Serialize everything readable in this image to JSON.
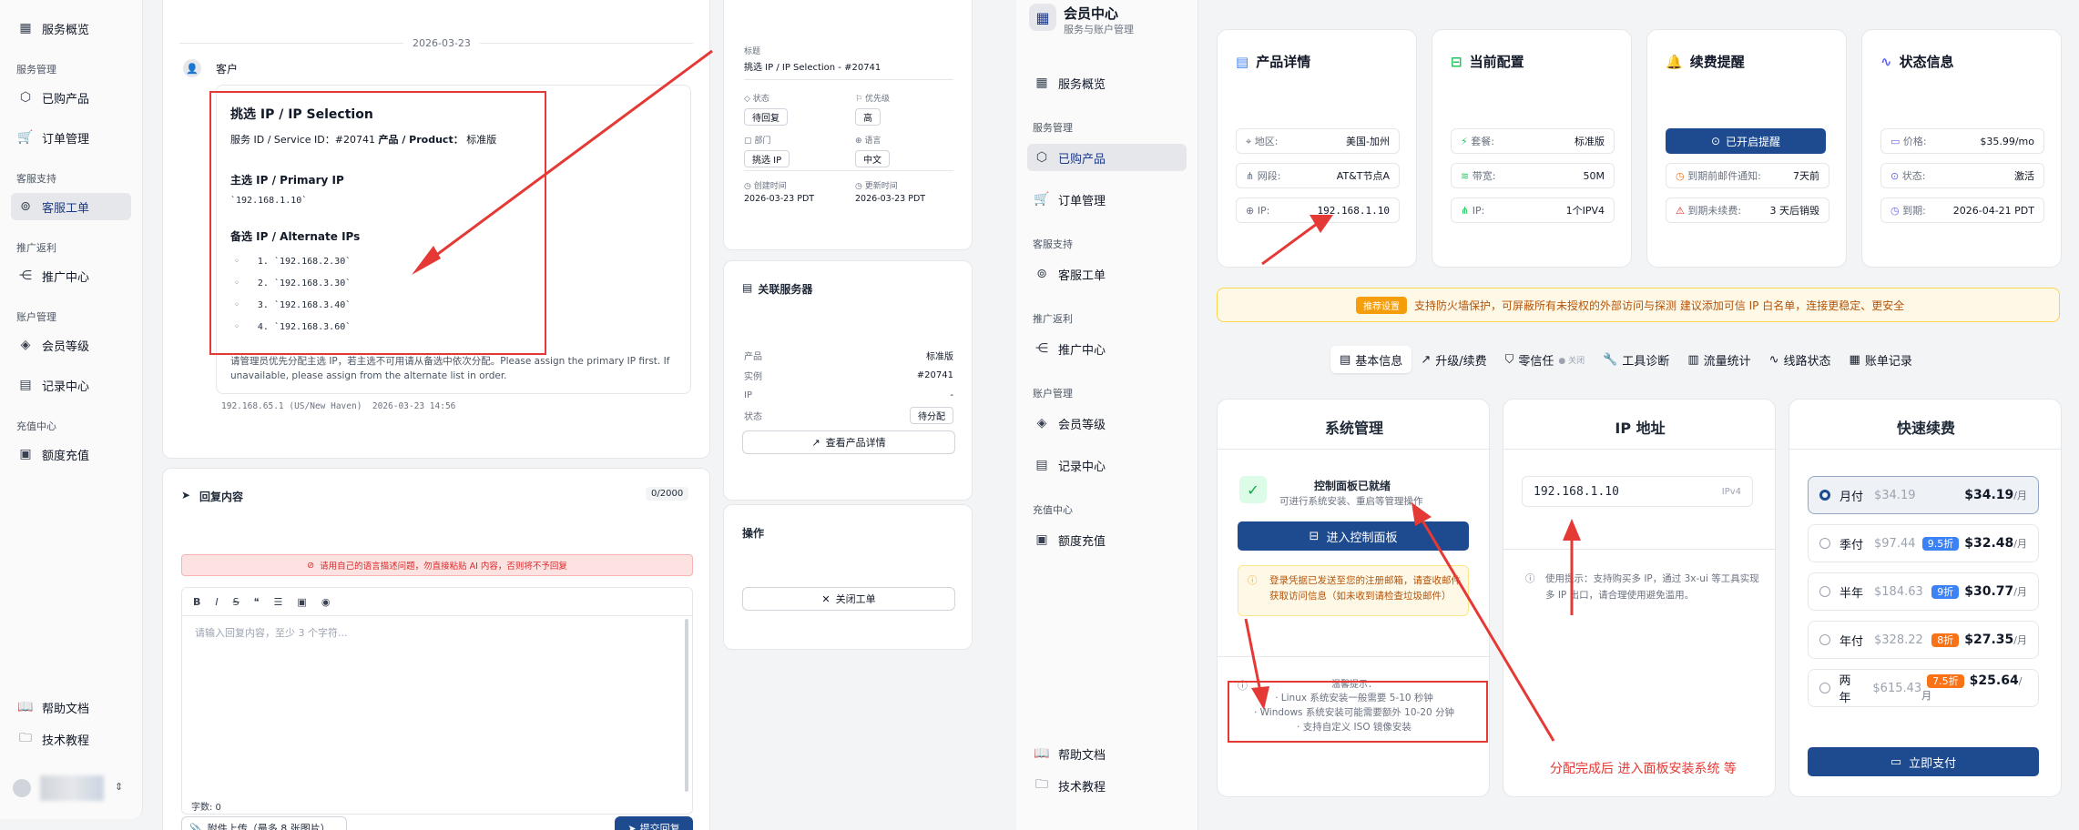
{
  "left_sidebar": {
    "items": [
      {
        "type": "item",
        "label": "服务概览",
        "icon": "grid-icon"
      },
      {
        "type": "group",
        "label": "服务管理"
      },
      {
        "type": "item",
        "label": "已购产品",
        "icon": "box-icon"
      },
      {
        "type": "item",
        "label": "订单管理",
        "icon": "cart-icon"
      },
      {
        "type": "group",
        "label": "客服支持"
      },
      {
        "type": "item",
        "label": "客服工单",
        "icon": "lifebuoy-icon",
        "active": true
      },
      {
        "type": "group",
        "label": "推广返利"
      },
      {
        "type": "item",
        "label": "推广中心",
        "icon": "share-icon"
      },
      {
        "type": "group",
        "label": "账户管理"
      },
      {
        "type": "item",
        "label": "会员等级",
        "icon": "badge-icon"
      },
      {
        "type": "item",
        "label": "记录中心",
        "icon": "record-icon"
      },
      {
        "type": "group",
        "label": "充值中心"
      },
      {
        "type": "item",
        "label": "额度充值",
        "icon": "wallet-icon"
      }
    ],
    "bottom": [
      {
        "label": "帮助文档",
        "icon": "book-icon"
      },
      {
        "label": "技术教程",
        "icon": "folder-icon"
      }
    ]
  },
  "ticket": {
    "date_divider": "2026-03-23",
    "sender": "客户",
    "msg_title": "挑选 IP / IP Selection",
    "service_prefix": "服务 ID / Service ID：",
    "service_id": "#20741",
    "product_prefix": "产品 / Product：",
    "product": "标准版",
    "primary_heading": "主选 IP / Primary IP",
    "primary_ip": "`192.168.1.10`",
    "alt_heading": "备选 IP / Alternate IPs",
    "alt_ips": [
      "1. `192.168.2.30`",
      "2. `192.168.3.30`",
      "3. `192.168.3.40`",
      "4. `192.168.3.60`"
    ],
    "note": "请管理员优先分配主选 IP，若主选不可用请从备选中依次分配。Please assign the primary IP first. If unavailable, please assign from the alternate list in order.",
    "meta": "192.168.65.1 (US/New Haven)  2026-03-23 14:56"
  },
  "reply": {
    "title": "回复内容",
    "counter": "0/2000",
    "warning": "请用自己的语言描述问题，勿直接粘贴 AI 内容，否则将不予回复",
    "placeholder": "请输入回复内容，至少 3 个字符...",
    "char_count": "字数: 0",
    "attach": "附件上传（最多 8 张图片）",
    "submit": "提交回复"
  },
  "info": {
    "title_label": "标题",
    "title_value": "挑选 IP / IP Selection - #20741",
    "status_label": "状态",
    "status_value": "待回复",
    "priority_label": "优先级",
    "priority_value": "高",
    "dept_label": "部门",
    "dept_value": "挑选 IP",
    "lang_label": "语言",
    "lang_value": "中文",
    "created_label": "创建时间",
    "created_value": "2026-03-23 PDT",
    "updated_label": "更新时间",
    "updated_value": "2026-03-23 PDT"
  },
  "related": {
    "title": "关联服务器",
    "rows": [
      {
        "k": "产品",
        "v": "标准版"
      },
      {
        "k": "实例",
        "v": "#20741"
      },
      {
        "k": "IP",
        "v": "-"
      },
      {
        "k": "状态",
        "v": "待分配"
      }
    ],
    "view_button": "查看产品详情"
  },
  "ops": {
    "title": "操作",
    "close_button": "关闭工单"
  },
  "right_sidebar": {
    "app_title": "会员中心",
    "app_sub": "服务与账户管理",
    "items": [
      {
        "type": "item",
        "label": "服务概览",
        "icon": "grid-icon"
      },
      {
        "type": "group",
        "label": "服务管理"
      },
      {
        "type": "item",
        "label": "已购产品",
        "icon": "box-icon",
        "active": true
      },
      {
        "type": "item",
        "label": "订单管理",
        "icon": "cart-icon"
      },
      {
        "type": "group",
        "label": "客服支持"
      },
      {
        "type": "item",
        "label": "客服工单",
        "icon": "lifebuoy-icon"
      },
      {
        "type": "group",
        "label": "推广返利"
      },
      {
        "type": "item",
        "label": "推广中心",
        "icon": "share-icon"
      },
      {
        "type": "group",
        "label": "账户管理"
      },
      {
        "type": "item",
        "label": "会员等级",
        "icon": "badge-icon"
      },
      {
        "type": "item",
        "label": "记录中心",
        "icon": "record-icon"
      },
      {
        "type": "group",
        "label": "充值中心"
      },
      {
        "type": "item",
        "label": "额度充值",
        "icon": "wallet-icon"
      }
    ],
    "bottom": [
      {
        "label": "帮助文档",
        "icon": "book-icon"
      },
      {
        "label": "技术教程",
        "icon": "folder-icon"
      }
    ]
  },
  "product_detail": {
    "title": "产品详情",
    "rows": [
      {
        "k": "地区:",
        "v": "美国-加州"
      },
      {
        "k": "网段:",
        "v": "AT&T节点A"
      },
      {
        "k": "IP:",
        "v": "192.168.1.10"
      }
    ]
  },
  "config": {
    "title": "当前配置",
    "rows": [
      {
        "k": "套餐:",
        "v": "标准版"
      },
      {
        "k": "带宽:",
        "v": "50M"
      },
      {
        "k": "IP:",
        "v": "1个IPV4"
      }
    ]
  },
  "renew_remind": {
    "title": "续费提醒",
    "button": "已开启提醒",
    "rows": [
      {
        "k": "到期前邮件通知:",
        "v": "7天前"
      },
      {
        "k": "到期未续费:",
        "v": "3 天后销毁"
      }
    ]
  },
  "status_info": {
    "title": "状态信息",
    "rows": [
      {
        "k": "价格:",
        "v": "$35.99/mo"
      },
      {
        "k": "状态:",
        "v": "激活"
      },
      {
        "k": "到期:",
        "v": "2026-04-21 PDT"
      }
    ]
  },
  "banner": {
    "badge": "推荐设置",
    "text": "支持防火墙保护，可屏蔽所有未授权的外部访问与探测  建议添加可信 IP 白名单，连接更稳定、更安全"
  },
  "tabs": [
    {
      "label": "基本信息",
      "icon": "server-icon",
      "active": true
    },
    {
      "label": "升级/续费",
      "icon": "trend-icon"
    },
    {
      "label": "零信任",
      "icon": "shield-icon",
      "badge": "关闭"
    },
    {
      "label": "工具诊断",
      "icon": "wrench-icon"
    },
    {
      "label": "流量统计",
      "icon": "chart-icon"
    },
    {
      "label": "线路状态",
      "icon": "pulse-icon"
    },
    {
      "label": "账单记录",
      "icon": "receipt-icon"
    }
  ],
  "sys": {
    "title": "系统管理",
    "ready_title": "控制面板已就绪",
    "ready_sub": "可进行系统安装、重启等管理操作",
    "enter_button": "进入控制面板",
    "notice": "登录凭据已发送至您的注册邮箱，请查收邮件获取访问信息（如未收到请检查垃圾邮件）",
    "tips_title": "温馨提示：",
    "tips": [
      "· Linux 系统安装一般需要 5-10 秒钟",
      "· Windows 系统安装可能需要额外 10-20 分钟",
      "· 支持自定义 ISO 镜像安装"
    ]
  },
  "ip": {
    "title": "IP 地址",
    "value": "192.168.1.10",
    "type": "IPv4",
    "tip": "使用提示：支持购买多 IP，通过 3x-ui 等工具实现多 IP 出口，请合理使用避免滥用。"
  },
  "quick": {
    "title": "快速续费",
    "plans": [
      {
        "name": "月付",
        "orig": "$34.19",
        "disc": "",
        "price": "$34.19",
        "unit": "/月",
        "selected": true
      },
      {
        "name": "季付",
        "orig": "$97.44",
        "disc": "9.5折",
        "price": "$32.48",
        "unit": "/月",
        "color": "#3b82f6"
      },
      {
        "name": "半年",
        "orig": "$184.63",
        "disc": "9折",
        "price": "$30.77",
        "unit": "/月",
        "color": "#3b82f6"
      },
      {
        "name": "年付",
        "orig": "$328.22",
        "disc": "8折",
        "price": "$27.35",
        "unit": "/月",
        "color": "#f97316"
      },
      {
        "name": "两年",
        "orig": "$615.43",
        "disc": "7.5折",
        "price": "$25.64",
        "unit": "/月",
        "color": "#f97316"
      }
    ],
    "pay_button": "立即支付"
  },
  "annotation": "分配完成后 进入面板安装系统 等",
  "colors": {
    "primary": "#1e4b8f",
    "annotation_red": "#e53935"
  }
}
